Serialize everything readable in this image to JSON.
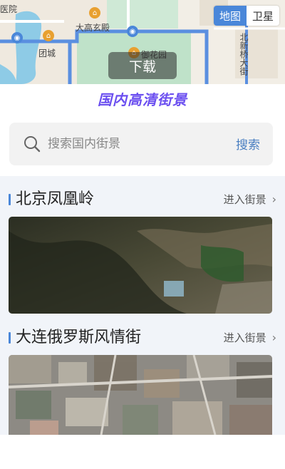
{
  "map": {
    "toggle": {
      "map_label": "地图",
      "satellite_label": "卫星",
      "active": "map"
    },
    "download_label": "下载",
    "labels": [
      "医院",
      "大高玄殿",
      "团城",
      "御花园",
      "北新桥大街"
    ]
  },
  "brand": {
    "title": "国内高清街景",
    "color": "#6b4ff0"
  },
  "search": {
    "placeholder": "搜索国内街景",
    "button_label": "搜索"
  },
  "sections": [
    {
      "title": "北京凤凰岭",
      "link_label": "进入街景",
      "image_icon": "satellite-aerial-image-mountains"
    },
    {
      "title": "大连俄罗斯风情街",
      "link_label": "进入街景",
      "image_icon": "satellite-aerial-image-city"
    }
  ],
  "colors": {
    "accent": "#4a87d9",
    "search_button": "#4a7fc1",
    "content_bg": "#f1f4f9"
  }
}
